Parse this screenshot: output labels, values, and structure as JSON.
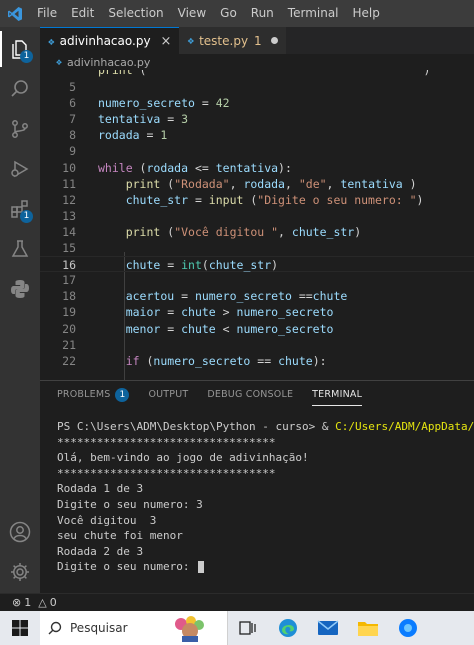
{
  "menu": [
    "File",
    "Edit",
    "Selection",
    "View",
    "Go",
    "Run",
    "Terminal",
    "Help"
  ],
  "activity_badges": {
    "explorer": "1",
    "extensions": "1"
  },
  "tabs": [
    {
      "name": "adivinhacao.py",
      "icon": "py",
      "state": "active"
    },
    {
      "name": "teste.py",
      "icon": "py",
      "count": "1",
      "state": "modified"
    }
  ],
  "breadcrumb": {
    "file": "adivinhacao.py",
    "icon": "py"
  },
  "editor": {
    "lines": [
      {
        "n": "5",
        "tokens": []
      },
      {
        "n": "6",
        "tokens": [
          [
            "v",
            "numero_secreto"
          ],
          [
            "o",
            " = "
          ],
          [
            "n",
            "42"
          ]
        ]
      },
      {
        "n": "7",
        "tokens": [
          [
            "v",
            "tentativa"
          ],
          [
            "o",
            " = "
          ],
          [
            "n",
            "3"
          ]
        ]
      },
      {
        "n": "8",
        "tokens": [
          [
            "v",
            "rodada"
          ],
          [
            "o",
            " = "
          ],
          [
            "n",
            "1"
          ]
        ]
      },
      {
        "n": "9",
        "tokens": []
      },
      {
        "n": "10",
        "tokens": [
          [
            "k",
            "while"
          ],
          [
            "o",
            " ("
          ],
          [
            "v",
            "rodada"
          ],
          [
            "o",
            " <= "
          ],
          [
            "v",
            "tentativa"
          ],
          [
            "o",
            "):"
          ]
        ]
      },
      {
        "n": "11",
        "tokens": [
          [
            "o",
            "    "
          ],
          [
            "f",
            "print"
          ],
          [
            "o",
            " ("
          ],
          [
            "s",
            "\"Rodada\""
          ],
          [
            "o",
            ", "
          ],
          [
            "v",
            "rodada"
          ],
          [
            "o",
            ", "
          ],
          [
            "s",
            "\"de\""
          ],
          [
            "o",
            ", "
          ],
          [
            "v",
            "tentativa"
          ],
          [
            "o",
            " )"
          ]
        ]
      },
      {
        "n": "12",
        "tokens": [
          [
            "o",
            "    "
          ],
          [
            "v",
            "chute_str"
          ],
          [
            "o",
            " = "
          ],
          [
            "f",
            "input"
          ],
          [
            "o",
            " ("
          ],
          [
            "s",
            "\"Digite o seu numero: \""
          ],
          [
            "o",
            ")"
          ]
        ]
      },
      {
        "n": "13",
        "tokens": []
      },
      {
        "n": "14",
        "tokens": [
          [
            "o",
            "    "
          ],
          [
            "f",
            "print"
          ],
          [
            "o",
            " ("
          ],
          [
            "s",
            "\"Você digitou \""
          ],
          [
            "o",
            ", "
          ],
          [
            "v",
            "chute_str"
          ],
          [
            "o",
            ")"
          ]
        ]
      },
      {
        "n": "15",
        "tokens": []
      },
      {
        "n": "16",
        "tokens": [
          [
            "o",
            "    "
          ],
          [
            "v",
            "chute"
          ],
          [
            "o",
            " = "
          ],
          [
            "t",
            "int"
          ],
          [
            "o",
            "("
          ],
          [
            "v",
            "chute_str"
          ],
          [
            "o",
            ")"
          ]
        ],
        "current": true
      },
      {
        "n": "17",
        "tokens": []
      },
      {
        "n": "18",
        "tokens": [
          [
            "o",
            "    "
          ],
          [
            "v",
            "acertou"
          ],
          [
            "o",
            " = "
          ],
          [
            "v",
            "numero_secreto"
          ],
          [
            "o",
            " =="
          ],
          [
            "v",
            "chute"
          ]
        ]
      },
      {
        "n": "19",
        "tokens": [
          [
            "o",
            "    "
          ],
          [
            "v",
            "maior"
          ],
          [
            "o",
            " = "
          ],
          [
            "v",
            "chute"
          ],
          [
            "o",
            " > "
          ],
          [
            "v",
            "numero_secreto"
          ]
        ]
      },
      {
        "n": "20",
        "tokens": [
          [
            "o",
            "    "
          ],
          [
            "v",
            "menor"
          ],
          [
            "o",
            " = "
          ],
          [
            "v",
            "chute"
          ],
          [
            "o",
            " < "
          ],
          [
            "v",
            "numero_secreto"
          ]
        ]
      },
      {
        "n": "21",
        "tokens": []
      },
      {
        "n": "22",
        "tokens": [
          [
            "o",
            "    "
          ],
          [
            "k",
            "if"
          ],
          [
            "o",
            " ("
          ],
          [
            "v",
            "numero_secreto"
          ],
          [
            "o",
            " == "
          ],
          [
            "v",
            "chute"
          ],
          [
            "o",
            "):"
          ]
        ]
      }
    ],
    "partial_top": [
      [
        "f",
        "print"
      ],
      [
        "o",
        " ("
      ],
      [
        "s",
        "\"                                      \""
      ],
      [
        "o",
        ")"
      ]
    ]
  },
  "panel": {
    "tabs": [
      {
        "label": "PROBLEMS",
        "badge": "1"
      },
      {
        "label": "OUTPUT"
      },
      {
        "label": "DEBUG CONSOLE"
      },
      {
        "label": "TERMINAL",
        "active": true
      }
    ],
    "terminal": {
      "prompt": "PS C:\\Users\\ADM\\Desktop\\Python - curso> & ",
      "command_path": "C:/Users/ADM/AppData/Local/Pr",
      "lines": [
        "*********************************",
        "Olá, bem-vindo ao jogo de adivinhação!",
        "*********************************",
        "Rodada 1 de 3",
        "Digite o seu numero: 3",
        "Você digitou  3",
        "seu chute foi menor",
        "Rodada 2 de 3"
      ],
      "current_input": "Digite o seu numero: "
    }
  },
  "status": {
    "errors": "1",
    "warnings": "0"
  },
  "taskbar": {
    "search_placeholder": "Pesquisar"
  },
  "colors": {
    "accent": "#0078d4",
    "badge": "#0e639c",
    "keyword": "#c586c0",
    "variable": "#9cdcfe",
    "string": "#ce9178",
    "number": "#b5cea8",
    "function": "#dcdcaa",
    "type": "#4ec9b0"
  }
}
